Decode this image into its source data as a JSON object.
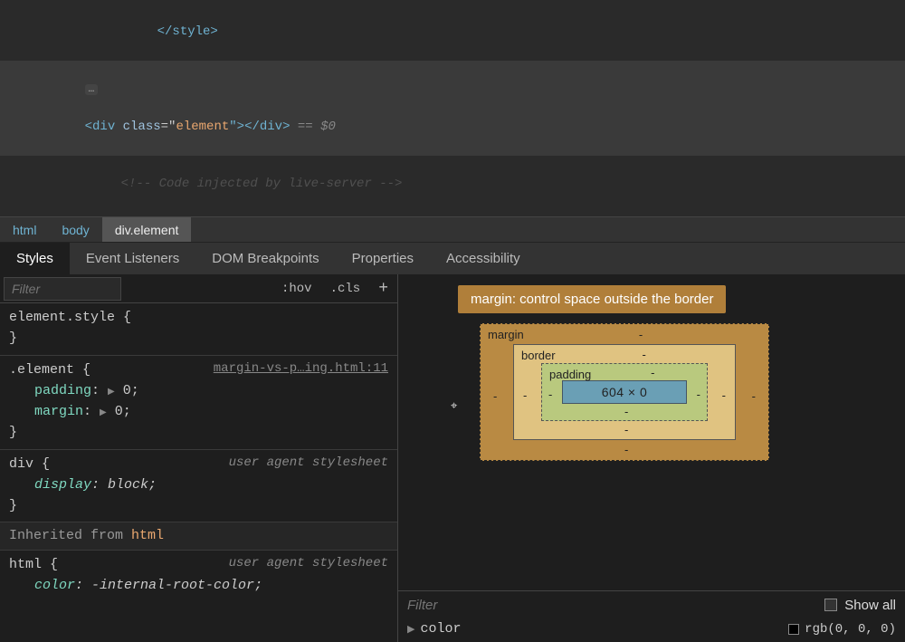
{
  "dom": {
    "line0": "</style>",
    "line1": {
      "open": "<div ",
      "attrName": "class",
      "eq": "=\"",
      "attrVal": "element",
      "close": "\"></div>",
      "meta": " == $0"
    },
    "line2": "<!-- Code injected by live-server -->"
  },
  "breadcrumb": [
    {
      "label": "html"
    },
    {
      "label": "body"
    },
    {
      "label": "div.element"
    }
  ],
  "tabs": [
    {
      "label": "Styles"
    },
    {
      "label": "Event Listeners"
    },
    {
      "label": "DOM Breakpoints"
    },
    {
      "label": "Properties"
    },
    {
      "label": "Accessibility"
    }
  ],
  "filterbar": {
    "placeholder": "Filter",
    "hov": ":hov",
    "cls": ".cls",
    "plus": "+"
  },
  "rules": {
    "elementStyle": {
      "selector": "element.style {",
      "close": "}"
    },
    "element": {
      "selector": ".element",
      "brace": " {",
      "source": "margin-vs-p…ing.html:11",
      "props": [
        {
          "name": "padding",
          "val": "0"
        },
        {
          "name": "margin",
          "val": "0"
        }
      ],
      "close": "}"
    },
    "div": {
      "selector": "div",
      "brace": " {",
      "ua": "user agent stylesheet",
      "props": [
        {
          "name": "display",
          "val": "block"
        }
      ],
      "close": "}"
    },
    "inheritLabelPrefix": "Inherited from ",
    "inheritLabelHtml": "html",
    "html": {
      "selector": "html",
      "brace": " {",
      "ua": "user agent stylesheet",
      "props": [
        {
          "name": "color",
          "val": "-internal-root-color"
        }
      ],
      "close": "}"
    }
  },
  "tooltip": "margin: control space outside the border",
  "boxmodel": {
    "margin": "margin",
    "border": "border",
    "padding": "padding",
    "dash": "-",
    "content": "604 × 0"
  },
  "computed": {
    "filterPlaceholder": "Filter",
    "showAll": "Show all",
    "colorName": "color",
    "colorVal": "rgb(0, 0, 0)"
  }
}
